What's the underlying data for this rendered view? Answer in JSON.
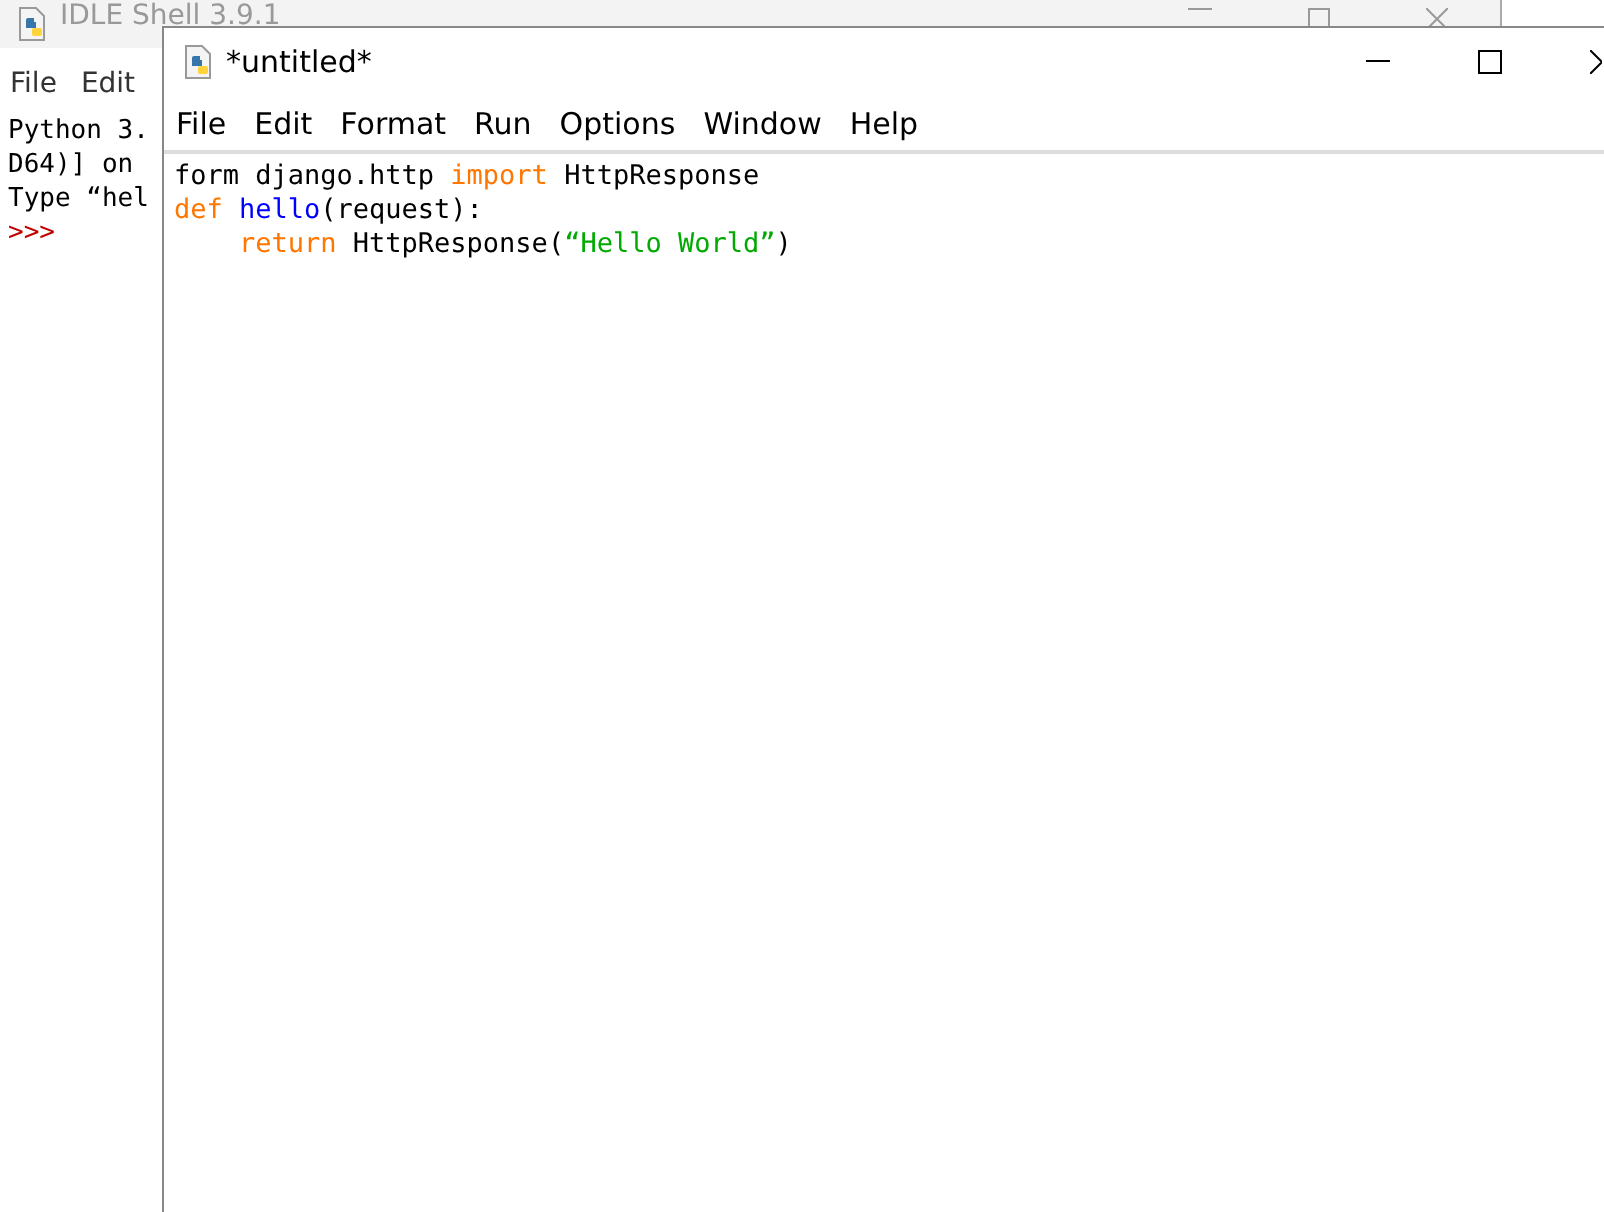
{
  "shell_window": {
    "title": "IDLE Shell 3.9.1",
    "menu": [
      "File",
      "Edit"
    ],
    "lines": [
      {
        "tokens": [
          {
            "kind": "plain",
            "text": "Python 3."
          }
        ]
      },
      {
        "tokens": [
          {
            "kind": "plain",
            "text": "D64)] on"
          }
        ]
      },
      {
        "tokens": [
          {
            "kind": "plain",
            "text": "Type “hel"
          }
        ]
      },
      {
        "tokens": [
          {
            "kind": "prompt",
            "text": ">>>"
          }
        ]
      }
    ]
  },
  "editor_window": {
    "title": "*untitled*",
    "menu": [
      "File",
      "Edit",
      "Format",
      "Run",
      "Options",
      "Window",
      "Help"
    ],
    "lines": [
      {
        "kind": "top",
        "tokens": [
          {
            "kind": "plain",
            "text": "form django.http"
          },
          {
            "kind": "keyword",
            "text": "import",
            "space_before": true
          },
          {
            "kind": "plain",
            "text": "HttpResponse",
            "space_before": true
          }
        ]
      },
      {
        "kind": "top",
        "tokens": [
          {
            "kind": "keyword",
            "text": "def"
          },
          {
            "kind": "definition",
            "text": "hello",
            "space_before": true
          },
          {
            "kind": "plain",
            "text": "(request):"
          }
        ]
      },
      {
        "kind": "indented",
        "tokens": [
          {
            "kind": "keyword",
            "text": "return"
          },
          {
            "kind": "plain",
            "text": "HttpResponse(",
            "space_before": true
          },
          {
            "kind": "string",
            "text": "“Hello World”"
          },
          {
            "kind": "plain",
            "text": ")"
          }
        ]
      }
    ]
  }
}
